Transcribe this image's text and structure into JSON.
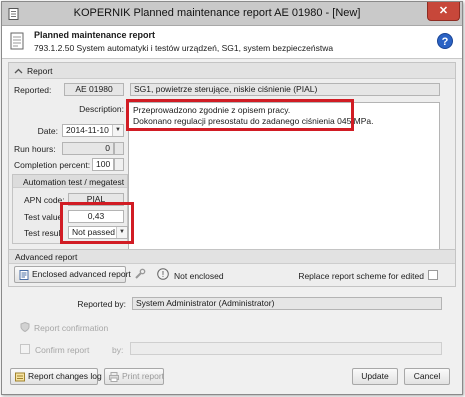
{
  "window": {
    "title": "KOPERNIK Planned maintenance report AE 01980 - [New]",
    "close_glyph": "✕"
  },
  "header": {
    "title": "Planned maintenance report",
    "subtitle": "793.1.2.50 System automatyki i testów urządzeń, SG1, system bezpieczeństwa",
    "help_glyph": "?"
  },
  "report": {
    "group_title": "Report",
    "reported_label": "Reported:",
    "reported_code": "AE 01980",
    "reported_name": "SG1, powietrze sterujące, niskie ciśnienie (PIAL)",
    "description_label": "Description:",
    "description_lines": [
      "Przeprowadzono zgodnie z opisem pracy.",
      "Dokonano regulacji presostatu do zadanego ciśnienia 045 MPa."
    ],
    "date_label": "Date:",
    "date_value": "2014-11-10",
    "run_hours_label": "Run hours:",
    "run_hours_value": "0",
    "completion_label": "Completion percent:",
    "completion_value": "100"
  },
  "automation": {
    "title": "Automation test / megatest",
    "apn_label": "APN code:",
    "apn_value": "PIAL",
    "test_value_label": "Test value",
    "test_value": "0,43",
    "test_result_label": "Test result",
    "test_result_value": "Not passed"
  },
  "advanced": {
    "group_title": "Advanced report",
    "enclosed_button": "Enclosed advanced report",
    "not_enclosed_text": "Not enclosed",
    "replace_label": "Replace report scheme for edited"
  },
  "reported_by": {
    "label": "Reported by:",
    "value": "System Administrator (Administrator)"
  },
  "confirmation": {
    "group_title": "Report confirmation",
    "confirm_label": "Confirm report",
    "by_label": "by:"
  },
  "footer": {
    "changes_log": "Report changes log",
    "print": "Print report",
    "update": "Update",
    "cancel": "Cancel"
  },
  "colors": {
    "highlight": "#d11c24",
    "help_blue": "#2a62c4",
    "close_red": "#c7473a"
  }
}
